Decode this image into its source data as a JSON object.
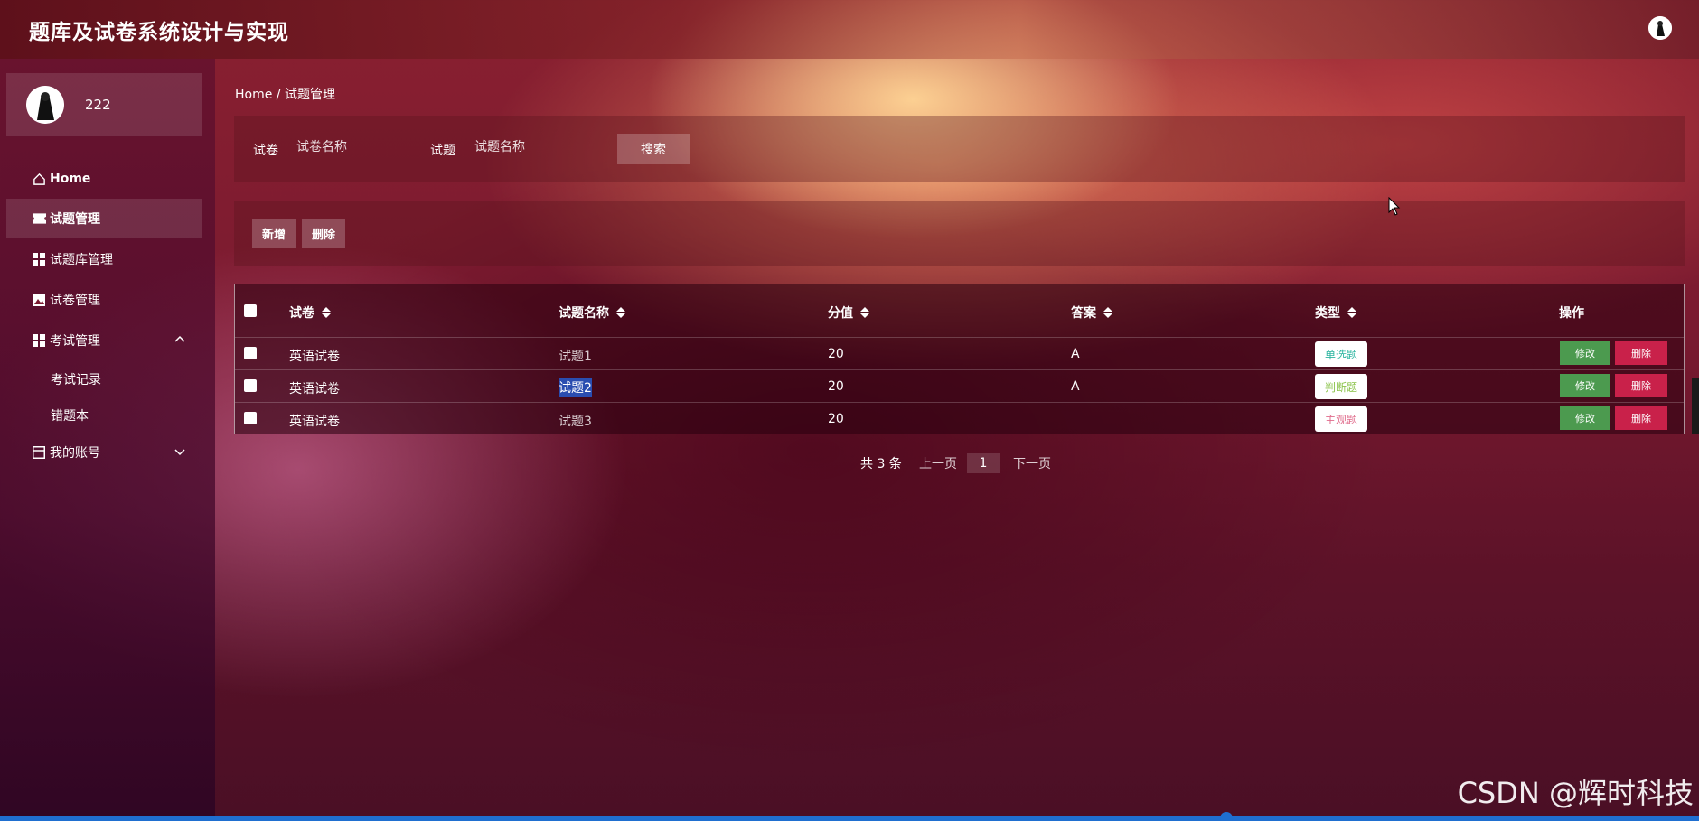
{
  "app": {
    "title": "题库及试卷系统设计与实现"
  },
  "user": {
    "name": "222"
  },
  "sidebar": {
    "items": [
      {
        "label": "Home",
        "icon": "home-icon"
      },
      {
        "label": "试题管理",
        "icon": "ticket-icon"
      },
      {
        "label": "试题库管理",
        "icon": "grid-icon"
      },
      {
        "label": "试卷管理",
        "icon": "image-icon"
      },
      {
        "label": "考试管理",
        "icon": "grid-icon"
      },
      {
        "label": "我的账号",
        "icon": "window-icon"
      }
    ],
    "exam_sub": [
      {
        "label": "考试记录"
      },
      {
        "label": "错题本"
      }
    ]
  },
  "breadcrumb": "Home / 试题管理",
  "search": {
    "paper_label": "试卷",
    "paper_placeholder": "试卷名称",
    "question_label": "试题",
    "question_placeholder": "试题名称",
    "button": "搜索"
  },
  "actions": {
    "add": "新增",
    "delete": "删除"
  },
  "table": {
    "headers": [
      "试卷",
      "试题名称",
      "分值",
      "答案",
      "类型",
      "操作"
    ],
    "rows": [
      {
        "paper": "英语试卷",
        "question": "试题1",
        "score": "20",
        "answer": "A",
        "type": "单选题",
        "type_color": "#2bb5a0"
      },
      {
        "paper": "英语试卷",
        "question": "试题2",
        "score": "20",
        "answer": "A",
        "type": "判断题",
        "type_color": "#8bc34a"
      },
      {
        "paper": "英语试卷",
        "question": "试题3",
        "score": "20",
        "answer": "",
        "type": "主观题",
        "type_color": "#e06c8c"
      }
    ],
    "edit_label": "修改",
    "delete_label": "删除"
  },
  "pagination": {
    "total": "共 3 条",
    "prev": "上一页",
    "page": "1",
    "next": "下一页"
  },
  "watermark": "CSDN @辉时科技",
  "colors": {
    "edit": "#4c9a4f",
    "delete": "#c9214a"
  }
}
